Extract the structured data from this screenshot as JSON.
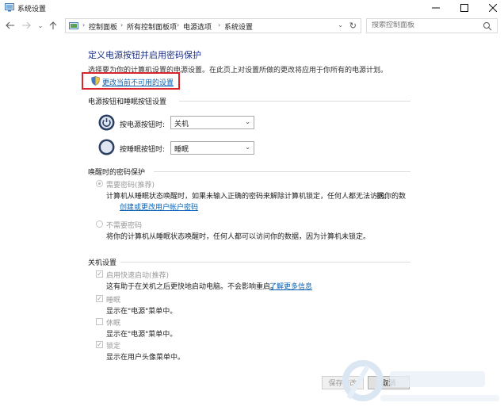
{
  "window": {
    "title": "系统设置"
  },
  "breadcrumb": [
    "控制面板",
    "所有控制面板项",
    "电源选项",
    "系统设置"
  ],
  "search": {
    "placeholder": "搜索控制面板"
  },
  "page": {
    "heading": "定义电源按钮并启用密码保护",
    "description": "选择要为你的计算机设置的电源设置。在此页上对设置所做的更改将应用于你所有的电源计划。",
    "change_link": "更改当前不可用的设置"
  },
  "power_buttons": {
    "section_title": "电源按钮和睡眠按钮设置",
    "power_label": "按电源按钮时:",
    "power_value": "关机",
    "sleep_label": "按睡眠按钮时:",
    "sleep_value": "睡眠"
  },
  "password": {
    "section_title": "唤醒时的密码保护",
    "require_label": "需要密码(推荐)",
    "require_desc": "计算机从睡眠状态唤醒时，如果未输入正确的密码来解除计算机锁定，任何人都无法访问你的数",
    "require_desc2": "据。",
    "create_link": "创建或更改用户帐户密码",
    "no_label": "不需要密码",
    "no_desc": "将你的计算机从睡眠状态唤醒时，任何人都可以访问你的数据，因为计算机未锁定。"
  },
  "shutdown": {
    "section_title": "关机设置",
    "fast_label": "启用快速启动(推荐)",
    "fast_desc": "这有助于在关机之后更快地启动电脑。不会影响重启。",
    "learn_more": "了解更多信息",
    "sleep_label": "睡眠",
    "sleep_desc": "显示在\"电源\"菜单中。",
    "hibernate_label": "休眠",
    "hibernate_desc": "显示在\"电源\"菜单中。",
    "lock_label": "锁定",
    "lock_desc": "显示在用户头像菜单中。",
    "states": {
      "fast": true,
      "sleep": true,
      "hibernate": false,
      "lock": true
    }
  },
  "buttons": {
    "save": "保存修改",
    "cancel": "取消"
  },
  "colors": {
    "accent_link": "#0a63b5",
    "heading": "#1e3287",
    "highlight_box": "#d8262c"
  }
}
